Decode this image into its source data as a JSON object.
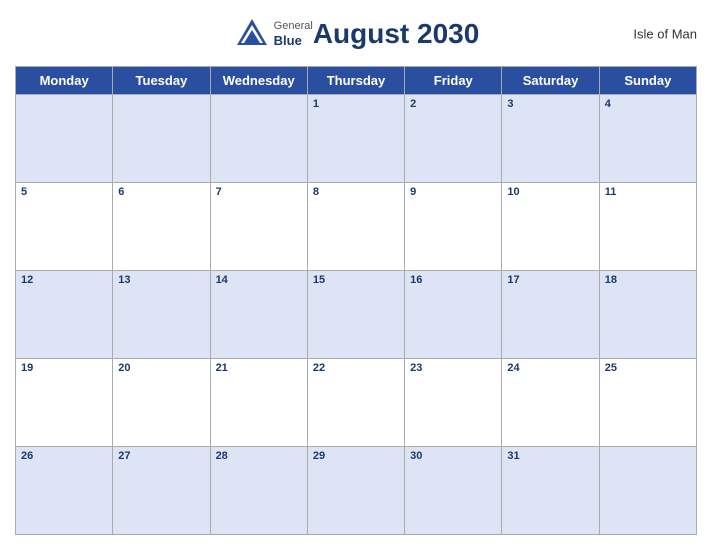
{
  "header": {
    "logo_general": "General",
    "logo_blue": "Blue",
    "month_title": "August 2030",
    "location": "Isle of Man"
  },
  "day_headers": [
    "Monday",
    "Tuesday",
    "Wednesday",
    "Thursday",
    "Friday",
    "Saturday",
    "Sunday"
  ],
  "weeks": [
    [
      {
        "num": "",
        "in_month": false
      },
      {
        "num": "",
        "in_month": false
      },
      {
        "num": "",
        "in_month": false
      },
      {
        "num": "1",
        "in_month": true
      },
      {
        "num": "2",
        "in_month": true
      },
      {
        "num": "3",
        "in_month": true
      },
      {
        "num": "4",
        "in_month": true
      }
    ],
    [
      {
        "num": "5",
        "in_month": true
      },
      {
        "num": "6",
        "in_month": true
      },
      {
        "num": "7",
        "in_month": true
      },
      {
        "num": "8",
        "in_month": true
      },
      {
        "num": "9",
        "in_month": true
      },
      {
        "num": "10",
        "in_month": true
      },
      {
        "num": "11",
        "in_month": true
      }
    ],
    [
      {
        "num": "12",
        "in_month": true
      },
      {
        "num": "13",
        "in_month": true
      },
      {
        "num": "14",
        "in_month": true
      },
      {
        "num": "15",
        "in_month": true
      },
      {
        "num": "16",
        "in_month": true
      },
      {
        "num": "17",
        "in_month": true
      },
      {
        "num": "18",
        "in_month": true
      }
    ],
    [
      {
        "num": "19",
        "in_month": true
      },
      {
        "num": "20",
        "in_month": true
      },
      {
        "num": "21",
        "in_month": true
      },
      {
        "num": "22",
        "in_month": true
      },
      {
        "num": "23",
        "in_month": true
      },
      {
        "num": "24",
        "in_month": true
      },
      {
        "num": "25",
        "in_month": true
      }
    ],
    [
      {
        "num": "26",
        "in_month": true
      },
      {
        "num": "27",
        "in_month": true
      },
      {
        "num": "28",
        "in_month": true
      },
      {
        "num": "29",
        "in_month": true
      },
      {
        "num": "30",
        "in_month": true
      },
      {
        "num": "31",
        "in_month": true
      },
      {
        "num": "",
        "in_month": false
      }
    ]
  ]
}
